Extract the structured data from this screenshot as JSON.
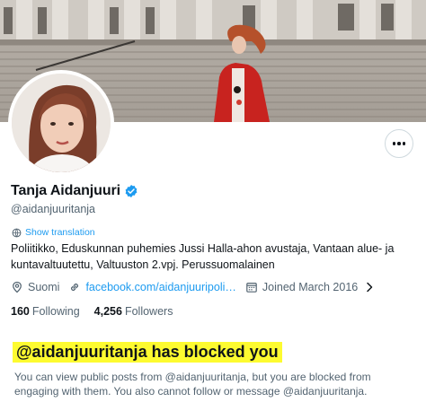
{
  "profile": {
    "display_name": "Tanja Aidanjuuri",
    "handle": "@aidanjuuritanja",
    "verified": true,
    "show_translation": "Show translation",
    "bio": "Poliitikko, Eduskunnan puhemies Jussi Halla-ahon avustaja, Vantaan alue- ja kuntavaltuutettu, Valtuuston 2.vpj. Perussuomalainen",
    "location": "Suomi",
    "website": "facebook.com/aidanjuuripoli…",
    "joined": "Joined March 2016",
    "following_count": "160",
    "following_label": "Following",
    "followers_count": "4,256",
    "followers_label": "Followers"
  },
  "blocked": {
    "title": "@aidanjuuritanja has blocked you",
    "message": "You can view public posts from @aidanjuuritanja, but you are blocked from engaging with them. You also cannot follow or message @aidanjuuritanja."
  },
  "icons": {
    "verified": "verified-badge-icon",
    "translate": "globe-icon",
    "location": "location-pin-icon",
    "link": "link-icon",
    "calendar": "calendar-icon",
    "more": "more-dots-icon"
  },
  "colors": {
    "accent": "#1d9bf0",
    "secondary_text": "#536471",
    "highlight": "#fdfb30"
  }
}
